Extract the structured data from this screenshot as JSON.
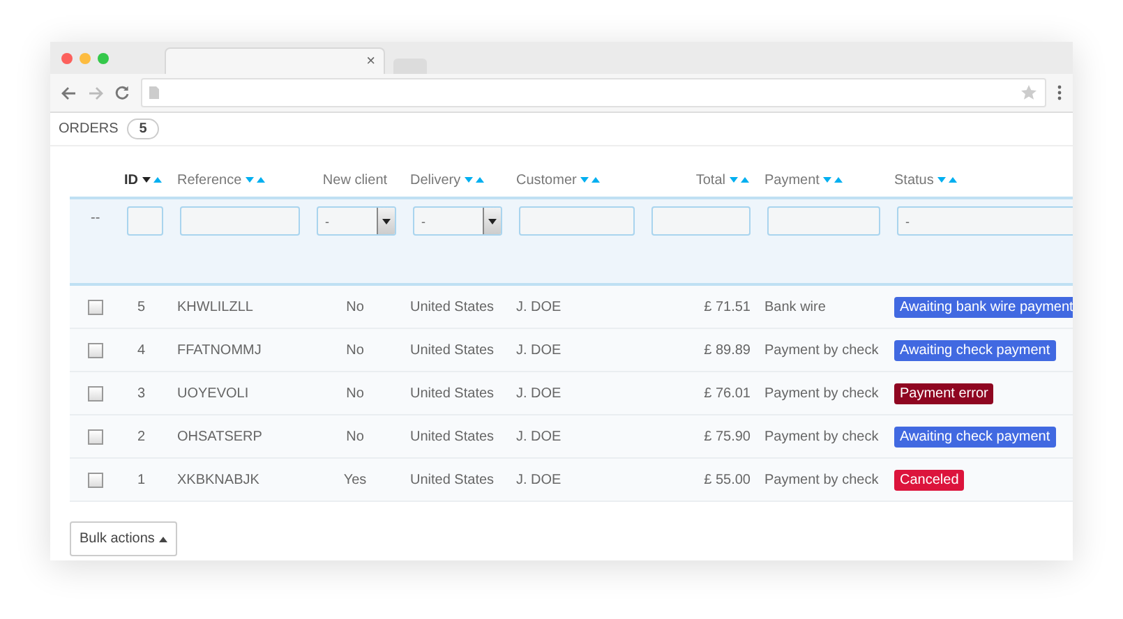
{
  "browser": {
    "tab_close": "×"
  },
  "header": {
    "title": "ORDERS",
    "count": "5"
  },
  "table": {
    "columns": [
      {
        "label": "ID",
        "sortable": true,
        "sorted": true
      },
      {
        "label": "Reference",
        "sortable": true,
        "sorted": false
      },
      {
        "label": "New client",
        "sortable": false
      },
      {
        "label": "Delivery",
        "sortable": true,
        "sorted": false
      },
      {
        "label": "Customer",
        "sortable": true,
        "sorted": false
      },
      {
        "label": "Total",
        "sortable": true,
        "sorted": false
      },
      {
        "label": "Payment",
        "sortable": true,
        "sorted": false
      },
      {
        "label": "Status",
        "sortable": true,
        "sorted": false
      }
    ],
    "filter_marker": "--",
    "filters": [
      {
        "kind": "text"
      },
      {
        "kind": "text"
      },
      {
        "kind": "select",
        "value": "-"
      },
      {
        "kind": "select",
        "value": "-"
      },
      {
        "kind": "text"
      },
      {
        "kind": "text"
      },
      {
        "kind": "text"
      },
      {
        "kind": "text",
        "value": "-"
      }
    ],
    "rows": [
      {
        "checked": false,
        "id": "5",
        "reference": "KHWLILZLL",
        "new_client": "No",
        "delivery": "United States",
        "customer": "J. DOE",
        "total": "£ 71.51",
        "payment": "Bank wire",
        "status": "Awaiting bank wire payment",
        "color": "#4169e1"
      },
      {
        "checked": false,
        "id": "4",
        "reference": "FFATNOMMJ",
        "new_client": "No",
        "delivery": "United States",
        "customer": "J. DOE",
        "total": "£ 89.89",
        "payment": "Payment by check",
        "status": "Awaiting check payment",
        "color": "#4169e1"
      },
      {
        "checked": false,
        "id": "3",
        "reference": "UOYEVOLI",
        "new_client": "No",
        "delivery": "United States",
        "customer": "J. DOE",
        "total": "£ 76.01",
        "payment": "Payment by check",
        "status": "Payment error",
        "color": "#8f0621"
      },
      {
        "checked": false,
        "id": "2",
        "reference": "OHSATSERP",
        "new_client": "No",
        "delivery": "United States",
        "customer": "J. DOE",
        "total": "£ 75.90",
        "payment": "Payment by check",
        "status": "Awaiting check payment",
        "color": "#4169e1"
      },
      {
        "checked": false,
        "id": "1",
        "reference": "XKBKNABJK",
        "new_client": "Yes",
        "delivery": "United States",
        "customer": "J. DOE",
        "total": "£ 55.00",
        "payment": "Payment by check",
        "status": "Canceled",
        "color": "#dc143c"
      }
    ]
  },
  "bulk_actions": "Bulk actions"
}
